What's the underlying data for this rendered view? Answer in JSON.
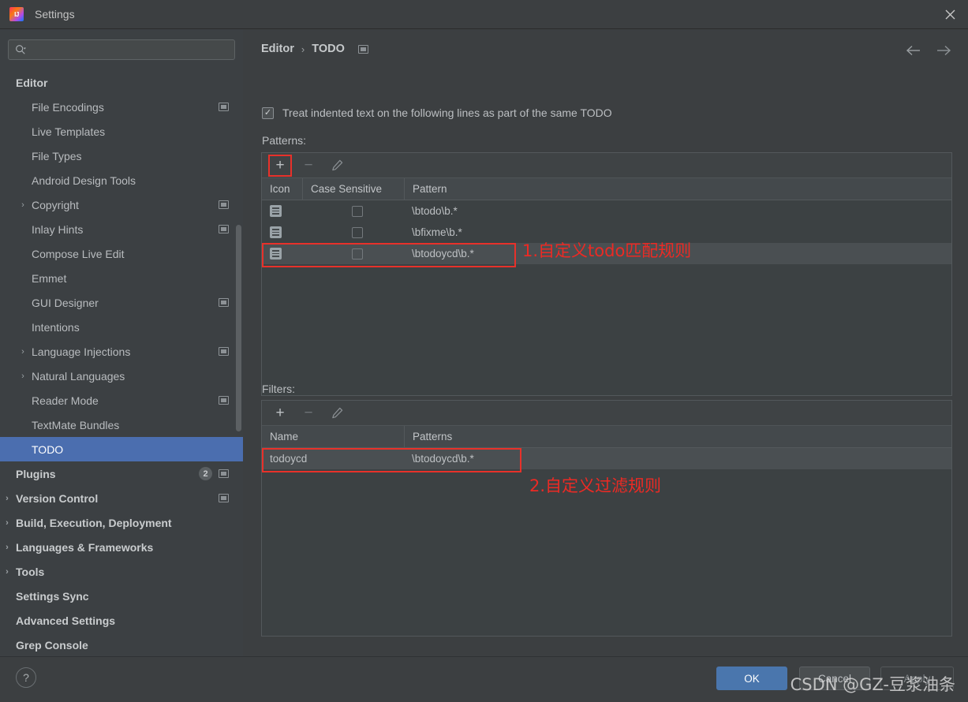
{
  "window": {
    "title": "Settings",
    "logo_icon": "intellij-idea-logo",
    "close_icon": "close-icon"
  },
  "sidebar": {
    "search": {
      "placeholder": "",
      "value": "",
      "icon": "search-icon",
      "dropdown_icon": "chevron-down-icon"
    },
    "items": [
      {
        "label": "Editor",
        "level": 0,
        "bold": true,
        "arrow": "",
        "trailing_icon": false,
        "selected": false
      },
      {
        "label": "File Encodings",
        "level": 1,
        "bold": false,
        "arrow": "",
        "trailing_icon": true,
        "selected": false
      },
      {
        "label": "Live Templates",
        "level": 1,
        "bold": false,
        "arrow": "",
        "trailing_icon": false,
        "selected": false
      },
      {
        "label": "File Types",
        "level": 1,
        "bold": false,
        "arrow": "",
        "trailing_icon": false,
        "selected": false
      },
      {
        "label": "Android Design Tools",
        "level": 1,
        "bold": false,
        "arrow": "",
        "trailing_icon": false,
        "selected": false
      },
      {
        "label": "Copyright",
        "level": 1,
        "bold": false,
        "arrow": "›",
        "trailing_icon": true,
        "selected": false
      },
      {
        "label": "Inlay Hints",
        "level": 1,
        "bold": false,
        "arrow": "",
        "trailing_icon": true,
        "selected": false
      },
      {
        "label": "Compose Live Edit",
        "level": 1,
        "bold": false,
        "arrow": "",
        "trailing_icon": false,
        "selected": false
      },
      {
        "label": "Emmet",
        "level": 1,
        "bold": false,
        "arrow": "",
        "trailing_icon": false,
        "selected": false
      },
      {
        "label": "GUI Designer",
        "level": 1,
        "bold": false,
        "arrow": "",
        "trailing_icon": true,
        "selected": false
      },
      {
        "label": "Intentions",
        "level": 1,
        "bold": false,
        "arrow": "",
        "trailing_icon": false,
        "selected": false
      },
      {
        "label": "Language Injections",
        "level": 1,
        "bold": false,
        "arrow": "›",
        "trailing_icon": true,
        "selected": false
      },
      {
        "label": "Natural Languages",
        "level": 1,
        "bold": false,
        "arrow": "›",
        "trailing_icon": false,
        "selected": false
      },
      {
        "label": "Reader Mode",
        "level": 1,
        "bold": false,
        "arrow": "",
        "trailing_icon": true,
        "selected": false
      },
      {
        "label": "TextMate Bundles",
        "level": 1,
        "bold": false,
        "arrow": "",
        "trailing_icon": false,
        "selected": false
      },
      {
        "label": "TODO",
        "level": 1,
        "bold": false,
        "arrow": "",
        "trailing_icon": false,
        "selected": true
      },
      {
        "label": "Plugins",
        "level": 0,
        "bold": true,
        "arrow": "",
        "trailing_icon": true,
        "badge": "2",
        "selected": false
      },
      {
        "label": "Version Control",
        "level": 0,
        "bold": true,
        "arrow": "›",
        "trailing_icon": true,
        "selected": false
      },
      {
        "label": "Build, Execution, Deployment",
        "level": 0,
        "bold": true,
        "arrow": "›",
        "trailing_icon": false,
        "selected": false
      },
      {
        "label": "Languages & Frameworks",
        "level": 0,
        "bold": true,
        "arrow": "›",
        "trailing_icon": false,
        "selected": false
      },
      {
        "label": "Tools",
        "level": 0,
        "bold": true,
        "arrow": "›",
        "trailing_icon": false,
        "selected": false
      },
      {
        "label": "Settings Sync",
        "level": 0,
        "bold": true,
        "arrow": "",
        "trailing_icon": false,
        "selected": false
      },
      {
        "label": "Advanced Settings",
        "level": 0,
        "bold": true,
        "arrow": "",
        "trailing_icon": false,
        "selected": false
      },
      {
        "label": "Grep Console",
        "level": 0,
        "bold": true,
        "arrow": "",
        "trailing_icon": false,
        "selected": false
      }
    ]
  },
  "main": {
    "breadcrumb": {
      "root": "Editor",
      "separator": "›",
      "leaf": "TODO",
      "trailing_icon": "settings-rect-icon"
    },
    "nav": {
      "back_icon": "arrow-left-icon",
      "forward_icon": "arrow-right-icon"
    },
    "treat_indented": {
      "label": "Treat indented text on the following lines as part of the same TODO",
      "checked": true,
      "check_glyph": "✓"
    },
    "patterns": {
      "section_label": "Patterns:",
      "toolbar": {
        "add": "+",
        "remove": "−",
        "edit": "edit-pencil-icon"
      },
      "columns": [
        "Icon",
        "Case Sensitive",
        "Pattern"
      ],
      "rows": [
        {
          "icon": "todo-note-icon",
          "case_sensitive": false,
          "pattern": "\\btodo\\b.*",
          "selected": false,
          "highlighted": false
        },
        {
          "icon": "todo-note-icon",
          "case_sensitive": false,
          "pattern": "\\bfixme\\b.*",
          "selected": false,
          "highlighted": false
        },
        {
          "icon": "todo-note-icon",
          "case_sensitive": false,
          "pattern": "\\btodoycd\\b.*",
          "selected": true,
          "highlighted": true
        }
      ]
    },
    "filters": {
      "section_label": "Filters:",
      "toolbar": {
        "add": "+",
        "remove": "−",
        "edit": "edit-pencil-icon"
      },
      "columns": [
        "Name",
        "Patterns"
      ],
      "rows": [
        {
          "name": "todoycd",
          "patterns": "\\btodoycd\\b.*",
          "selected": true,
          "highlighted": true
        }
      ]
    },
    "annotations": [
      {
        "text": "1.自定义todo匹配规则",
        "color": "#ec2a24"
      },
      {
        "text": "2.自定义过滤规则",
        "color": "#ec2a24"
      }
    ]
  },
  "footer": {
    "help_icon": "question-mark-icon",
    "ok_label": "OK",
    "cancel_label": "Cancel",
    "apply_label": "Apply",
    "watermark": "CSDN @GZ-豆浆油条"
  },
  "colors": {
    "accent": "#4b6eaf",
    "ok_button": "#4a76ad",
    "annotation_red": "#ec2a24",
    "panel_bg": "#3c3f41",
    "table_bg": "#3c4143",
    "table_header": "#44494c",
    "row_selected": "#4a4f52"
  }
}
